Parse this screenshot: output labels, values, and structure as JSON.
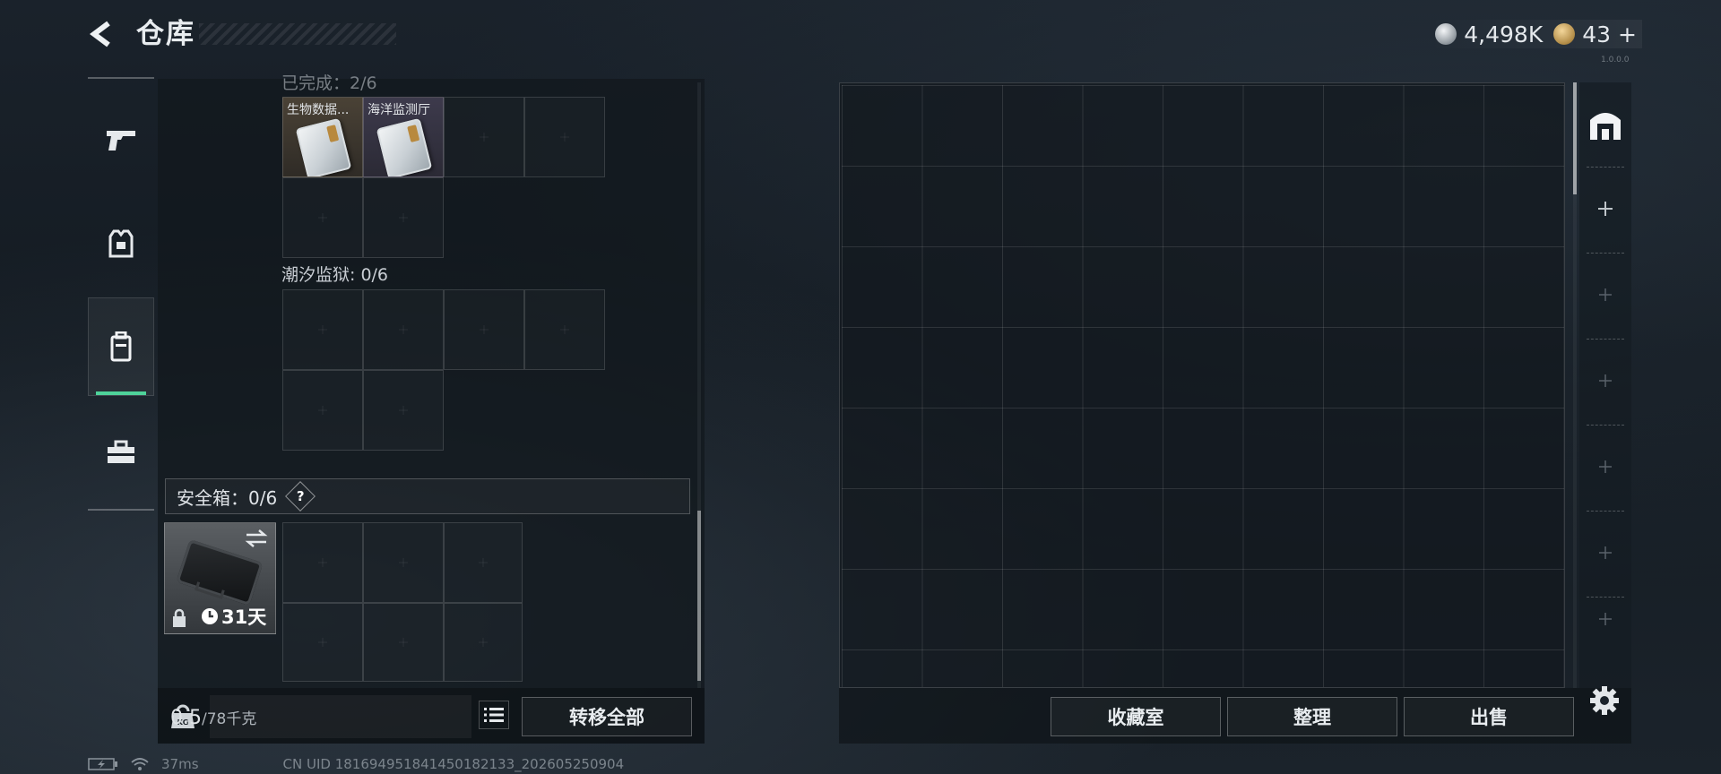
{
  "header": {
    "title": "仓库",
    "currencies": [
      {
        "icon": "silver-coin-icon",
        "value": "4,498K"
      },
      {
        "icon": "gold-coin-icon",
        "value": "43"
      }
    ],
    "add_label": "+",
    "version": "1.0.0.0"
  },
  "side_nav": {
    "items": [
      {
        "name": "weapons",
        "icon": "pistol-icon"
      },
      {
        "name": "armor",
        "icon": "vest-icon"
      },
      {
        "name": "backpack",
        "icon": "backpack-icon",
        "active": true
      },
      {
        "name": "toolbox",
        "icon": "toolbox-icon"
      }
    ]
  },
  "containers": [
    {
      "label": "已完成：2/6",
      "items": [
        {
          "name": "生物数据...",
          "rarity": "tan"
        },
        {
          "name": "海洋监测厅",
          "rarity": "purple"
        }
      ]
    },
    {
      "label": "潮汐监狱: 0/6",
      "items": []
    }
  ],
  "safe_box": {
    "title": "安全箱：0/6",
    "help": "?",
    "timer": "31天"
  },
  "weight": {
    "current": "0.5",
    "max": "/78千克"
  },
  "buttons": {
    "transfer_all": "转移全部",
    "collection": "收藏室",
    "organize": "整理",
    "sell": "出售"
  },
  "status_bar": {
    "ping": "37ms",
    "uid": "CN UID 1816949518414501821​33_202605250904"
  },
  "colors": {
    "accent_green": "#4ed29a",
    "rarity_tan": "#4a4236",
    "rarity_purple": "#3d3a4c"
  }
}
